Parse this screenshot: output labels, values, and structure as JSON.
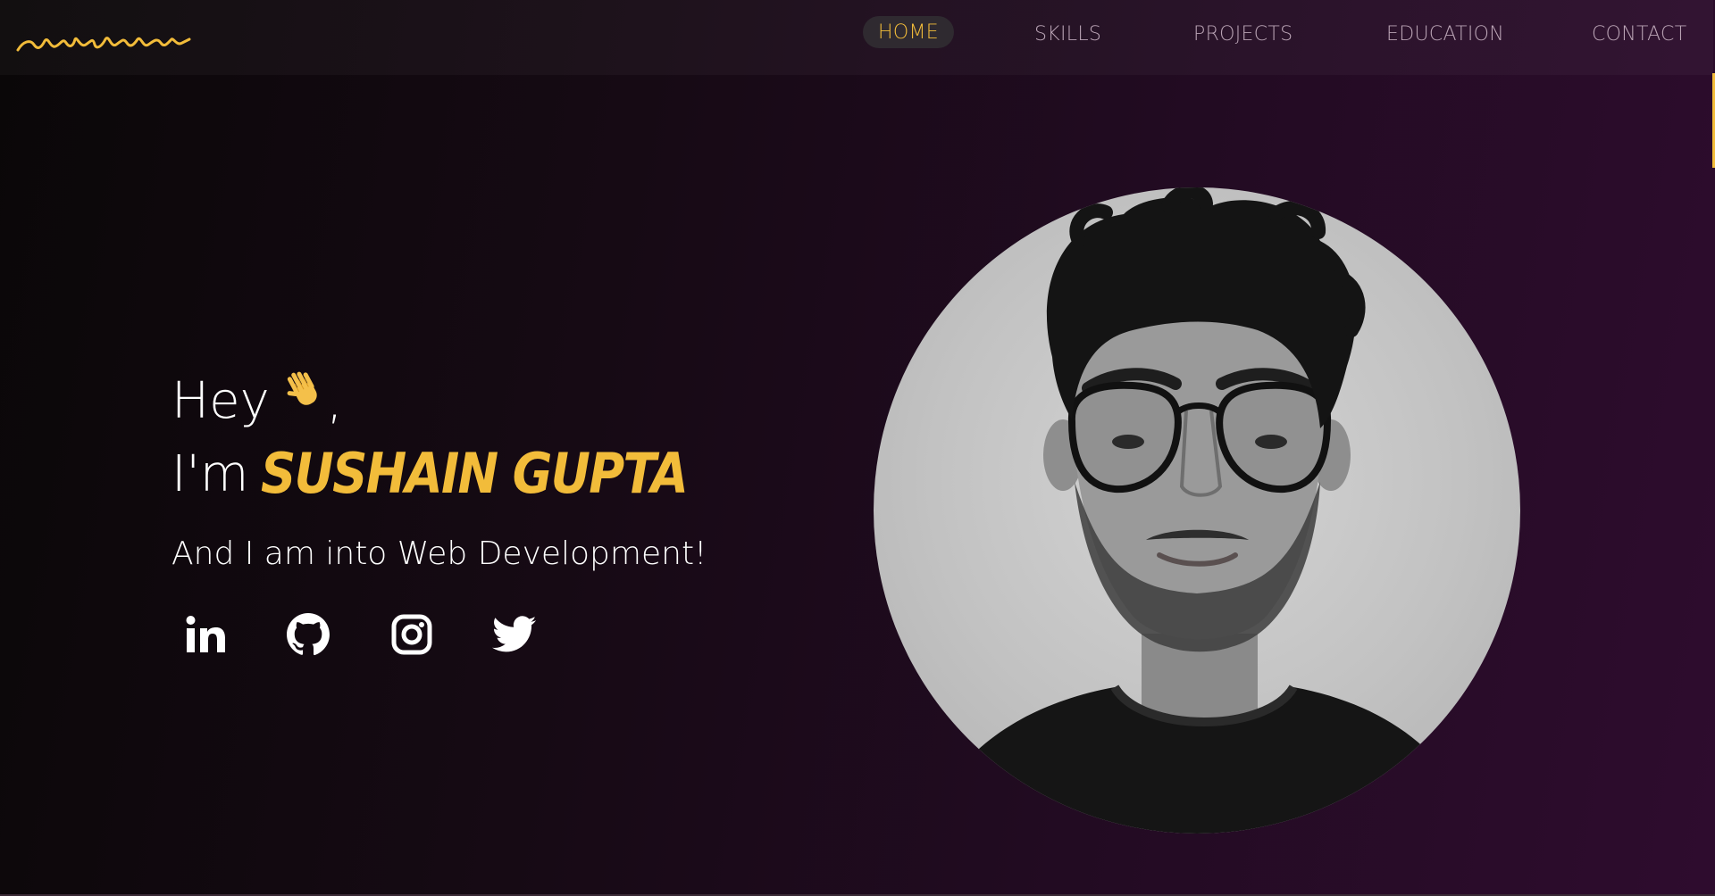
{
  "nav": {
    "items": [
      {
        "label": "HOME",
        "active": true
      },
      {
        "label": "SKILLS",
        "active": false
      },
      {
        "label": "PROJECTS",
        "active": false
      },
      {
        "label": "EDUCATION",
        "active": false
      },
      {
        "label": "CONTACT",
        "active": false
      }
    ]
  },
  "hero": {
    "greeting_hey": "Hey",
    "greeting_comma": ",",
    "im": "I'm",
    "name": "SUSHAIN GUPTA",
    "tagline": "And I am into Web Development!"
  },
  "social": [
    {
      "icon": "linkedin-icon"
    },
    {
      "icon": "github-icon"
    },
    {
      "icon": "instagram-icon"
    },
    {
      "icon": "twitter-icon"
    }
  ],
  "colors": {
    "accent": "#f2bc3a",
    "nav_text": "#b9a3b4",
    "nav_active_bg": "#2f2a30",
    "background_start": "#0a0708",
    "background_end": "#2e0c2e"
  }
}
